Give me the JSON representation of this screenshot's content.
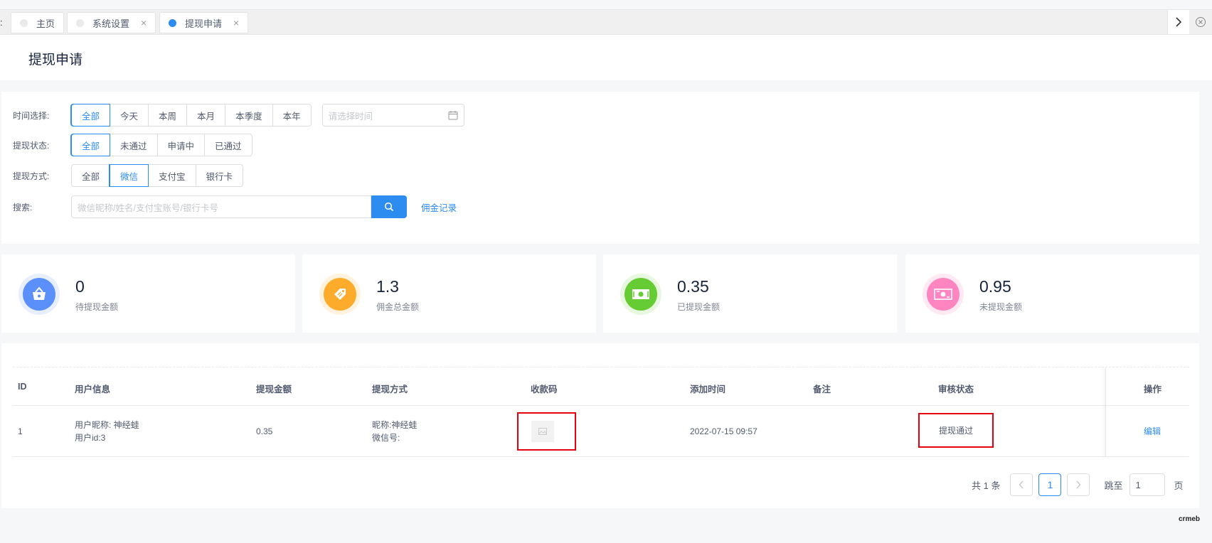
{
  "tabs": [
    {
      "label": "主页",
      "active": false,
      "closable": false
    },
    {
      "label": "系统设置",
      "active": false,
      "closable": true
    },
    {
      "label": "提现申请",
      "active": true,
      "closable": true
    }
  ],
  "tab_close_glyph": "×",
  "page_title": "提现申请",
  "filters": {
    "time": {
      "label": "时间选择:",
      "options": [
        "全部",
        "今天",
        "本周",
        "本月",
        "本季度",
        "本年"
      ],
      "selected": "全部",
      "date_placeholder": "请选择时间"
    },
    "status": {
      "label": "提现状态:",
      "options": [
        "全部",
        "未通过",
        "申请中",
        "已通过"
      ],
      "selected": "全部"
    },
    "method": {
      "label": "提现方式:",
      "options": [
        "全部",
        "微信",
        "支付宝",
        "银行卡"
      ],
      "selected": "微信"
    },
    "search": {
      "label": "搜索:",
      "placeholder": "微信昵称/姓名/支付宝账号/银行卡号",
      "link": "佣金记录"
    }
  },
  "stats": [
    {
      "value": "0",
      "label": "待提现金额",
      "color": "#5b8ff9",
      "ring": "#e7eefe",
      "icon": "basket-icon"
    },
    {
      "value": "1.3",
      "label": "佣金总金额",
      "color": "#fdab2b",
      "ring": "#fff3df",
      "icon": "tag-icon"
    },
    {
      "value": "0.35",
      "label": "已提现金额",
      "color": "#66cc33",
      "ring": "#e8f7df",
      "icon": "cash-icon"
    },
    {
      "value": "0.95",
      "label": "未提现金额",
      "color": "#ff85c0",
      "ring": "#ffe9f3",
      "icon": "money-icon"
    }
  ],
  "table": {
    "columns": [
      "ID",
      "用户信息",
      "提现金额",
      "提现方式",
      "收款码",
      "添加时间",
      "备注",
      "审核状态",
      "操作"
    ],
    "rows": [
      {
        "id": "1",
        "user_nickname": "用户昵称: 神经蛙",
        "user_id": "用户id:3",
        "amount": "0.35",
        "method_nickname": "昵称:神经蛙",
        "method_wechat": "微信号:",
        "added_time": "2022-07-15 09:57",
        "remark": "",
        "status": "提现通过",
        "action": "编辑"
      }
    ]
  },
  "pagination": {
    "total_text": "共 1 条",
    "current": "1",
    "jump_label": "跳至",
    "jump_value": "1",
    "page_suffix": "页"
  },
  "brand": "crmeb"
}
